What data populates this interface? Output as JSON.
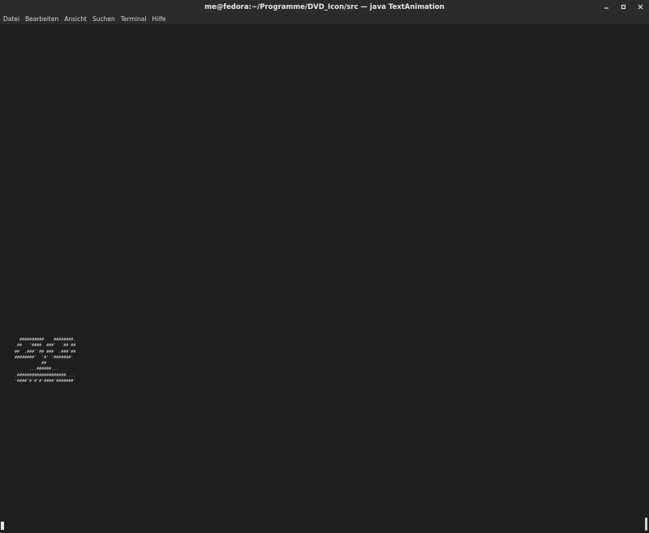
{
  "window": {
    "title": "me@fedora:~/Programme/DVD_Icon/src — java TextAnimation",
    "controls": {
      "minimize_icon": "minimize-icon",
      "maximize_icon": "maximize-icon",
      "close_icon": "close-icon"
    }
  },
  "menubar": {
    "items": [
      {
        "label": "Datei"
      },
      {
        "label": "Bearbeiten"
      },
      {
        "label": "Ansicht"
      },
      {
        "label": "Suchen"
      },
      {
        "label": "Terminal"
      },
      {
        "label": "Hilfe"
      }
    ]
  },
  "terminal": {
    "ascii_art": "  ##########    ########.\n ##   '####  ###'  '## ##\n##  .###''## ###  .###'##\n########'  '#' '#######'\n           ##\n      ...######...\n.####################....\n'####'#'#'#'####'#######'"
  },
  "colors": {
    "background": "#1e1e1e",
    "titlebar": "#2b2b2b",
    "text": "#c8c8c8"
  }
}
